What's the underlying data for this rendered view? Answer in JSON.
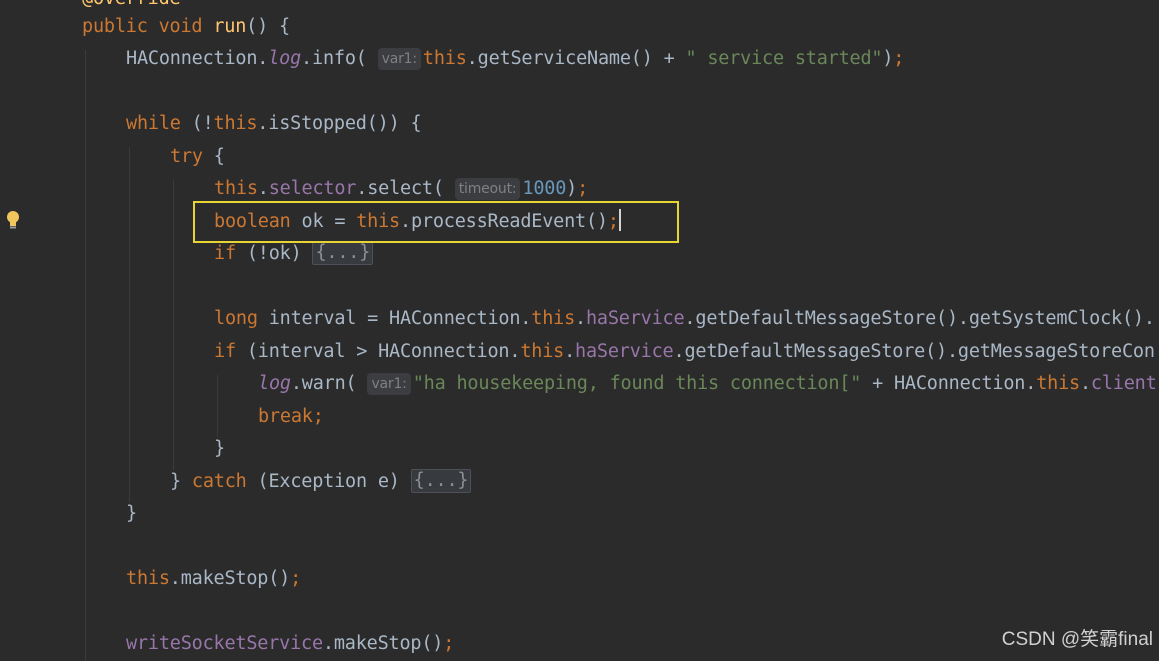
{
  "code": {
    "annotation": "@Override",
    "kw_public": "public",
    "kw_void": "void",
    "method_run": "run",
    "kw_while": "while",
    "kw_try": "try",
    "kw_this": "this",
    "kw_boolean": "boolean",
    "kw_if": "if",
    "kw_long": "long",
    "kw_break": "break",
    "kw_catch": "catch",
    "cls_ha": "HAConnection",
    "log": "log",
    "info_call": "info(",
    "warn_call": "warn(",
    "hint_var1": "var1:",
    "hint_timeout": "timeout:",
    "get_service_name": "getServiceName() + ",
    "str_started": "\" service started\"",
    "is_stopped": "isStopped()) {",
    "selector": "selector",
    "select_call": "select(",
    "num_1000": "1000",
    "ok_decl": " ok = ",
    "process_read": "processReadEvent()",
    "if_not_ok": " (!ok) ",
    "fold_dots": "{...}",
    "interval_decl": " interval = ",
    "ha_service": "haService",
    "line_interval_rest": "getDefaultMessageStore().getSystemClock().",
    "line_if_rest": "getDefaultMessageStore().getMessageStoreCon",
    "str_housekeeping": "\"ha housekeeping, found this connection[\"",
    "plus": " + ",
    "client_field": "client",
    "catch_exception": " (Exception e) ",
    "make_stop": "makeStop",
    "write_socket_service": "writeSocketService"
  },
  "watermark": "CSDN @笑霸final",
  "icons": {
    "gutter": "lightbulb-icon"
  }
}
